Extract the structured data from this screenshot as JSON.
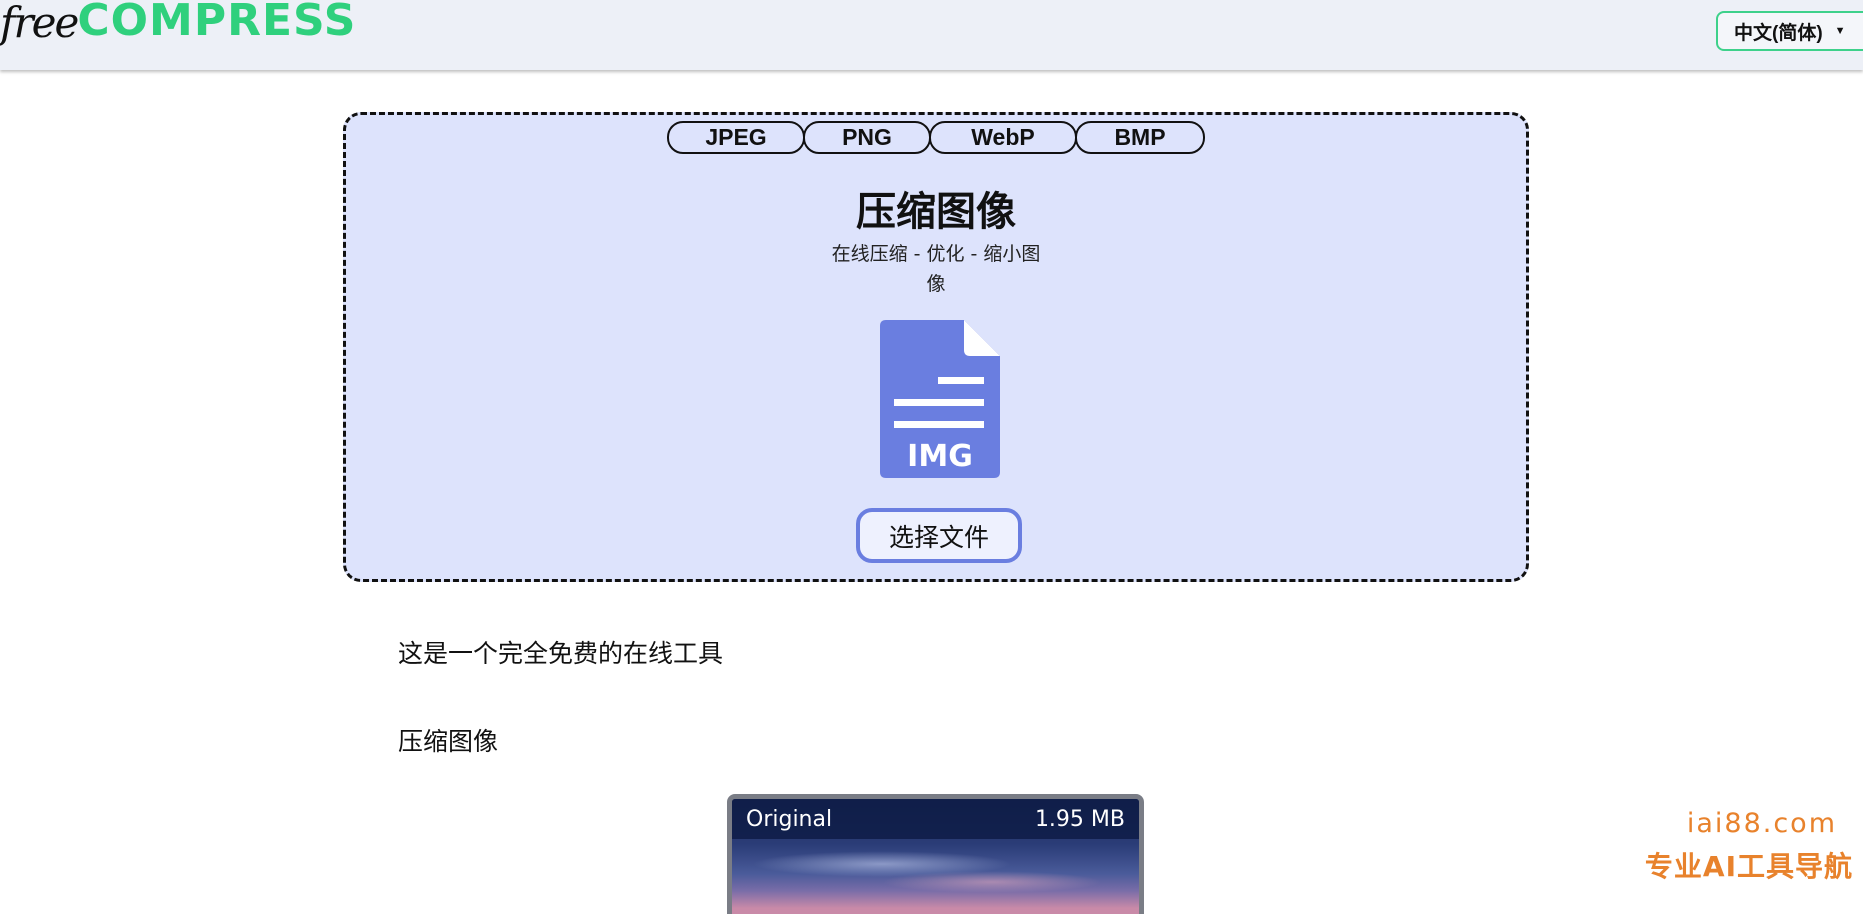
{
  "header": {
    "logo": {
      "part1": "free",
      "part2": "COMPRESS"
    },
    "language": "中文(简体)"
  },
  "upload": {
    "formats": [
      "JPEG",
      "PNG",
      "WebP",
      "BMP"
    ],
    "title": "压缩图像",
    "subtitle": "在线压缩 - 优化 - 缩小图像",
    "icon_label": "IMG",
    "choose_button": "选择文件"
  },
  "content": {
    "line1": "这是一个完全免费的在线工具",
    "line2": "压缩图像"
  },
  "preview": {
    "label": "Original",
    "size": "1.95 MB"
  },
  "watermark": {
    "domain": "iai88.com",
    "slogan": "专业AI工具导航"
  },
  "colors": {
    "brand_green": "#2fd07d",
    "upload_bg": "#dde3fc",
    "accent_blue": "#6a7ee0",
    "watermark": "#e8822c"
  }
}
